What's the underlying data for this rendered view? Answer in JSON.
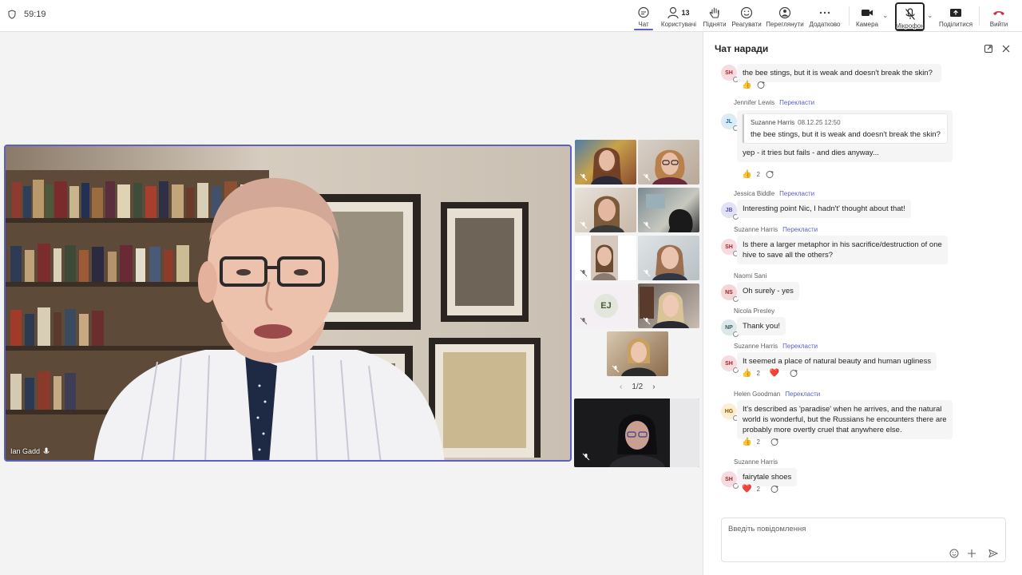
{
  "meeting": {
    "timer": "59:19",
    "icon": "shield-icon"
  },
  "toolbar": {
    "chat": {
      "label": "Чат",
      "icon": "chat-icon"
    },
    "people": {
      "label": "Користувачі",
      "count": "13",
      "icon": "people-icon"
    },
    "raise": {
      "label": "Підняти",
      "icon": "hand-icon"
    },
    "react": {
      "label": "Реагувати",
      "icon": "smile-icon"
    },
    "view": {
      "label": "Переглянути",
      "icon": "view-icon"
    },
    "more": {
      "label": "Додатково",
      "icon": "more-icon"
    },
    "camera": {
      "label": "Камера",
      "icon": "camera-icon"
    },
    "mic": {
      "label": "Мікрофон",
      "icon": "mic-off-icon"
    },
    "share": {
      "label": "Поділитися",
      "icon": "share-icon"
    },
    "leave": {
      "label": "Вийти",
      "icon": "phone-hangup-icon",
      "color": "#c4314b"
    }
  },
  "stage": {
    "main_participant": "Ian Gadd",
    "tile_initials": "EJ",
    "pager": "1/2"
  },
  "chat": {
    "title": "Чат наради",
    "translate_label": "Перекласти",
    "composer_placeholder": "Введіть повідомлення",
    "messages": [
      {
        "initials": "SH",
        "text": "the bee stings, but it is weak and doesn't break the skin?",
        "reactions": [
          {
            "emoji": "👍",
            "count": ""
          }
        ]
      },
      {
        "sender": "Jennifer Lewis",
        "initials": "JL",
        "quote_author": "Suzanne Harris",
        "quote_time": "08.12.25 12:50",
        "quote_text": "the bee stings, but it is weak and doesn't break the skin?",
        "text": "yep - it tries but fails - and dies anyway...",
        "reactions": [
          {
            "emoji": "👍",
            "count": "2"
          }
        ]
      },
      {
        "sender": "Jessica Biddle",
        "initials": "JB",
        "text": "Interesting point Nic, I hadn't' thought about that!"
      },
      {
        "sender": "Suzanne Harris",
        "initials": "SH",
        "text": "Is there a larger metaphor in his sacrifice/destruction of one hive to save all the others?"
      },
      {
        "sender": "Naomi Sani",
        "initials": "NS",
        "text": "Oh surely - yes"
      },
      {
        "sender": "Nicola Presley",
        "initials": "NP",
        "text": "Thank you!"
      },
      {
        "sender": "Suzanne Harris",
        "initials": "SH",
        "text": "It seemed a place of natural beauty and human ugliness",
        "reactions": [
          {
            "emoji": "👍",
            "count": "2"
          },
          {
            "emoji": "❤️",
            "count": ""
          }
        ]
      },
      {
        "sender": "Helen Goodman",
        "initials": "HG",
        "text": "It's described as 'paradise' when he arrives, and the natural world is wonderful, but the Russians he encounters there are probably more overtly cruel that anywhere else.",
        "reactions": [
          {
            "emoji": "👍",
            "count": "2"
          }
        ]
      },
      {
        "sender": "Suzanne Harris",
        "initials": "SH",
        "text": "fairytale shoes",
        "reactions": [
          {
            "emoji": "❤️",
            "count": "2"
          }
        ]
      }
    ]
  },
  "colors": {
    "accent": "#5b5fc7",
    "leave": "#c4314b"
  }
}
